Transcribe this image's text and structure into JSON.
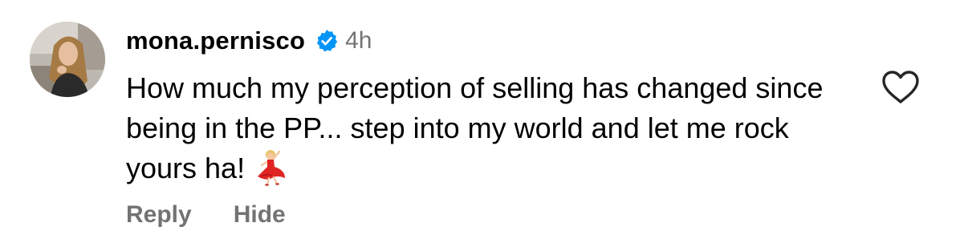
{
  "comment": {
    "username": "mona.pernisco",
    "verified": true,
    "timestamp": "4h",
    "text": "How much my perception of selling has changed since being in the PP... step into my world and let me rock yours ha!",
    "emoji": "dancer-emoji",
    "actions": {
      "reply_label": "Reply",
      "hide_label": "Hide"
    },
    "liked": false
  },
  "colors": {
    "username": "#000000",
    "text": "#000000",
    "secondary_text": "#737373",
    "verified_badge": "#0095F6",
    "like_icon_stroke": "#262626"
  },
  "icons": {
    "verified": "verified-badge-icon",
    "like": "heart-outline-icon"
  }
}
